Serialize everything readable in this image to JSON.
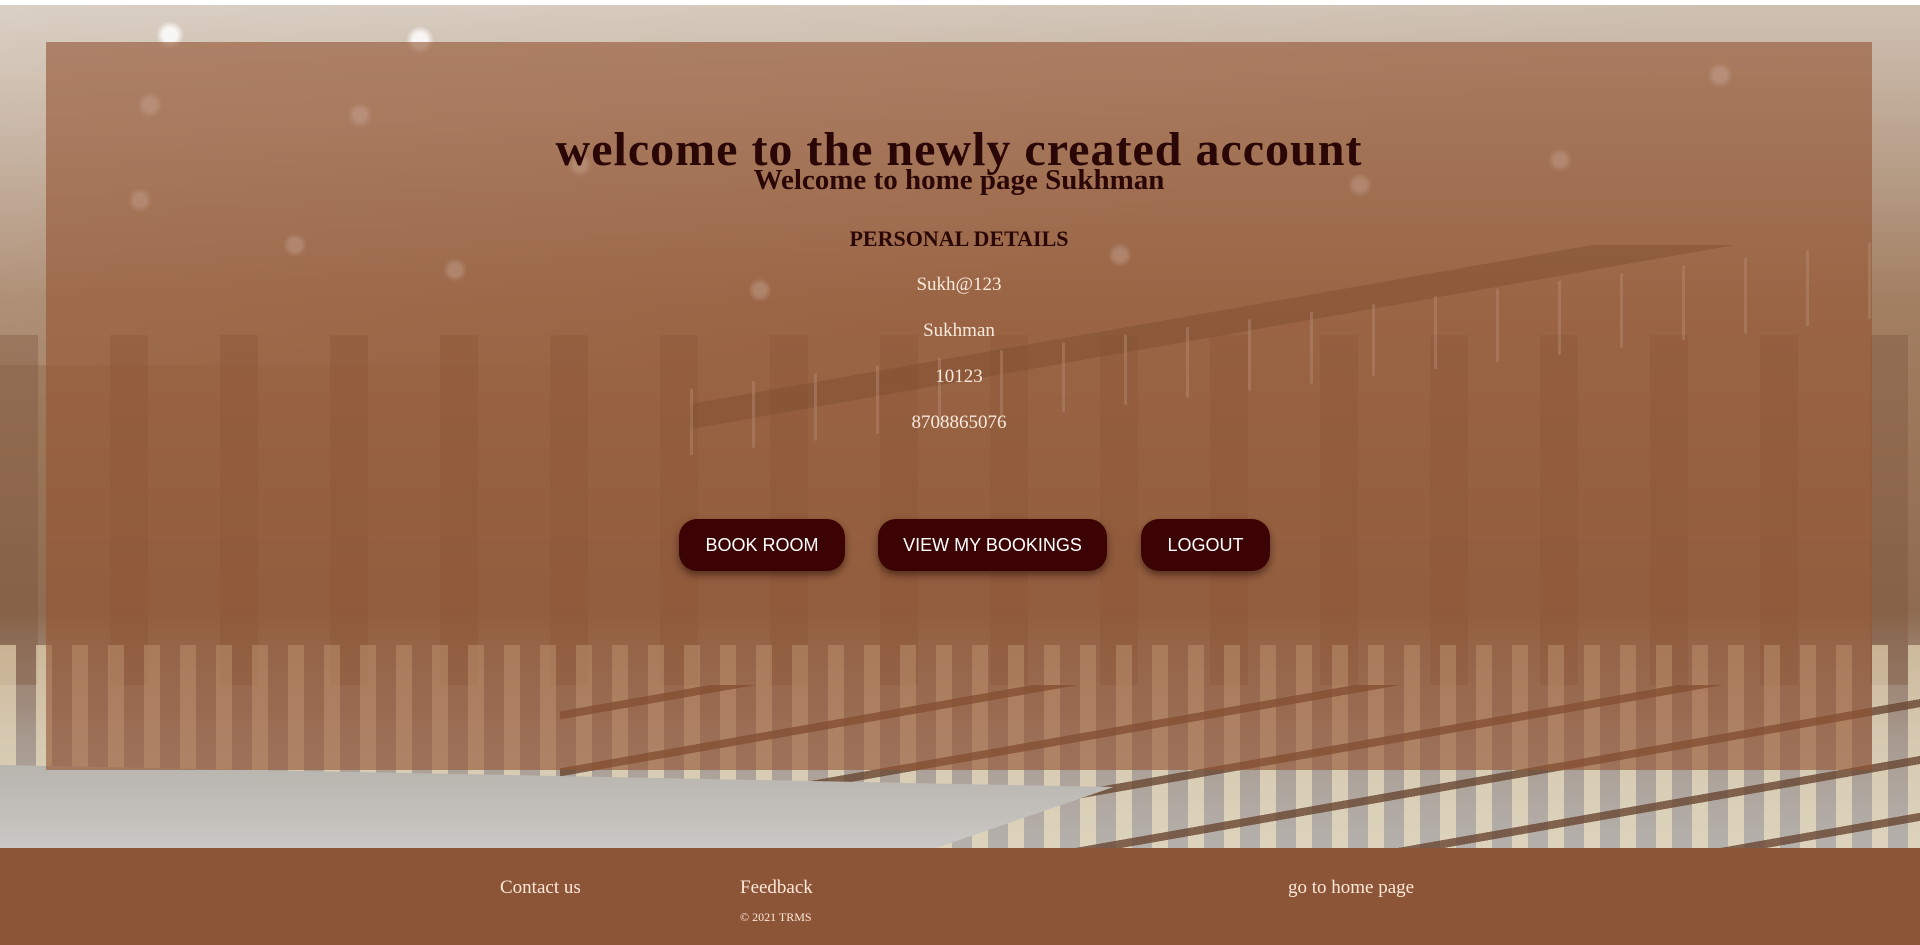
{
  "page": {
    "title": "welcome to the newly created account",
    "subtitle": "Welcome to home page Sukhman",
    "section_heading": "PERSONAL DETAILS"
  },
  "details": {
    "email": "Sukh@123",
    "name": "Sukhman",
    "id": "10123",
    "phone": "8708865076"
  },
  "buttons": {
    "book_room": "BOOK ROOM",
    "view_bookings": "VIEW MY BOOKINGS",
    "logout": "LOGOUT"
  },
  "footer": {
    "contact": "Contact us",
    "feedback": "Feedback",
    "copyright": "© 2021 TRMS",
    "home": "go to home page"
  },
  "colors": {
    "panel_overlay": "#94563499",
    "heading_text": "#2a0606",
    "button_bg": "#3b0304",
    "footer_bg": "#8c5538",
    "light_text": "#f7e9dc"
  }
}
